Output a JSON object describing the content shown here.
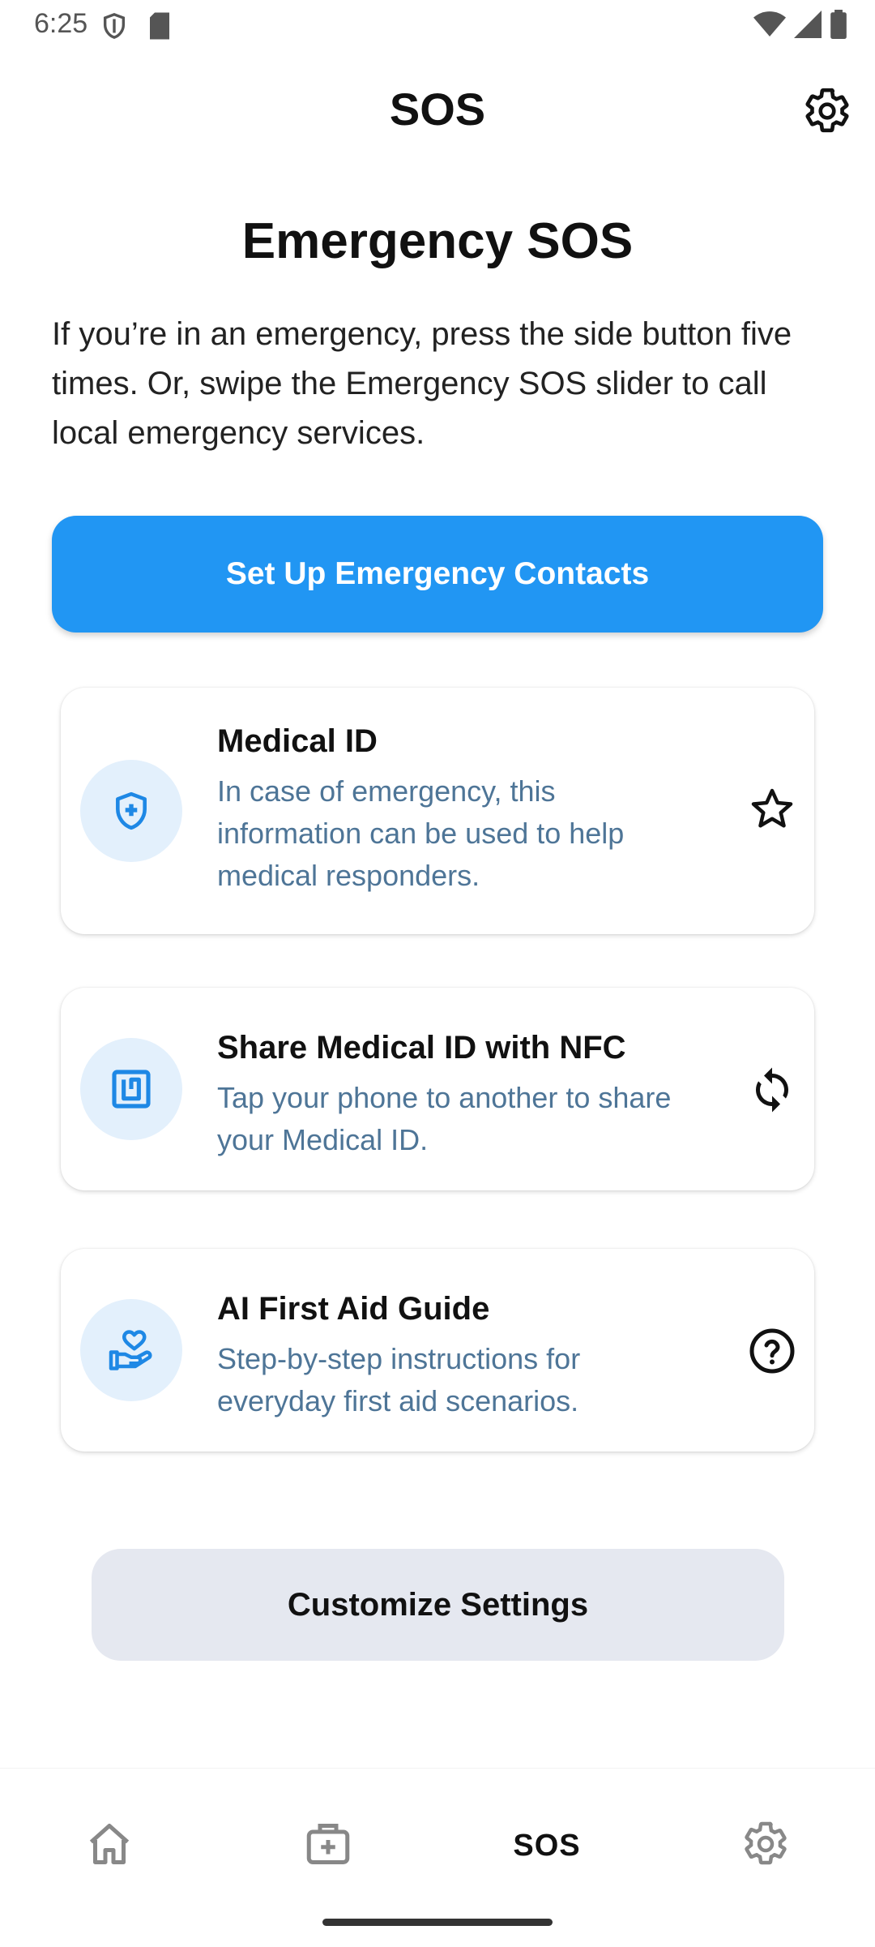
{
  "status": {
    "time": "6:25"
  },
  "app_bar": {
    "title": "SOS",
    "settings_icon": "gear-icon"
  },
  "hero": {
    "title": "Emergency SOS",
    "text": "If you’re in an emergency, press the side button five times. Or, swipe the Emergency SOS slider to call local emergency services."
  },
  "primary_button": {
    "label": "Set Up Emergency Contacts"
  },
  "cards": [
    {
      "title": "Medical ID",
      "desc": "In case of emergency, this information can be used to help medical responders.",
      "icon": "shield-plus-icon",
      "action_icon": "star-icon"
    },
    {
      "title": "Share Medical ID with NFC",
      "desc": "Tap your phone to another to share your Medical ID.",
      "icon": "nfc-icon",
      "action_icon": "sync-icon"
    },
    {
      "title": "AI First Aid Guide",
      "desc": "Step-by-step instructions for everyday first aid scenarios.",
      "icon": "hand-heart-icon",
      "action_icon": "help-icon"
    }
  ],
  "secondary_button": {
    "label": "Customize Settings"
  },
  "bottom_nav": {
    "items": [
      {
        "name": "home",
        "icon": "home-icon"
      },
      {
        "name": "medical",
        "icon": "medical-kit-icon"
      },
      {
        "name": "sos",
        "label": "SOS",
        "active": true
      },
      {
        "name": "settings",
        "icon": "gear-icon"
      }
    ]
  },
  "colors": {
    "accent": "#2196F3",
    "card_icon_bg": "#E3F0FC",
    "desc_text": "#4E7597",
    "secondary_btn": "#E5E8F0"
  }
}
